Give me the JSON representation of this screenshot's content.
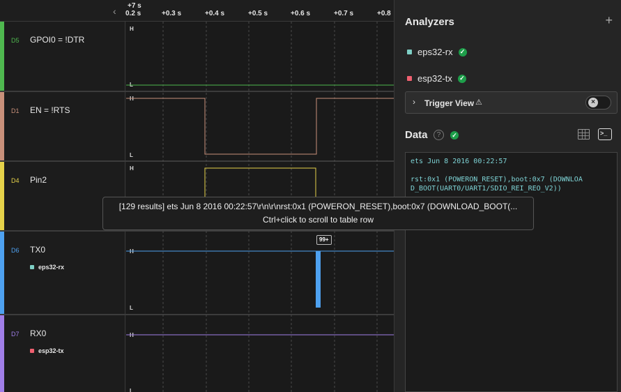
{
  "timeline": {
    "top_label": "+7 s",
    "ticks": [
      "0.2 s",
      "+0.3 s",
      "+0.4 s",
      "+0.5 s",
      "+0.6 s",
      "+0.7 s",
      "+0.8"
    ]
  },
  "channels": [
    {
      "id": "D5",
      "name": "GPOI0 =  !DTR",
      "color": "#4fb84f",
      "high": "H",
      "low": "L"
    },
    {
      "id": "D1",
      "name": "EN = !RTS",
      "color": "#c8907a",
      "high": "H",
      "low": "L"
    },
    {
      "id": "D4",
      "name": "Pin2",
      "color": "#e5d24a",
      "high": "H",
      "low": "L"
    },
    {
      "id": "D6",
      "name": "TX0",
      "color": "#4ea1f0",
      "high": "H",
      "low": "L",
      "analyzer": "eps32-rx",
      "analyzer_color": "#7ecfc5"
    },
    {
      "id": "D7",
      "name": "RX0",
      "color": "#a07ee8",
      "high": "H",
      "low": "L",
      "analyzer": "esp32-tx",
      "analyzer_color": "#f06070"
    }
  ],
  "tooltip": {
    "line1": "[129 results] ets Jun 8 2016 00:22:57\\r\\n\\r\\nrst:0x1 (POWERON_RESET),boot:0x7 (DOWNLOAD_BOOT(...",
    "line2": "Ctrl+click to scroll to table row"
  },
  "badge": "99+",
  "panel": {
    "title": "Analyzers",
    "add_icon": "plus-icon",
    "analyzers": [
      {
        "name": "eps32-rx",
        "color": "#7ecfc5"
      },
      {
        "name": "esp32-tx",
        "color": "#f06070"
      }
    ],
    "trigger_label": "Trigger View",
    "data_title": "Data",
    "terminal_lines": [
      "ets Jun  8 2016 00:22:57",
      "",
      "rst:0x1 (POWERON_RESET),boot:0x7 (DOWNLOA",
      "D_BOOT(UART0/UART1/SDIO_REI_REO_V2))"
    ]
  }
}
